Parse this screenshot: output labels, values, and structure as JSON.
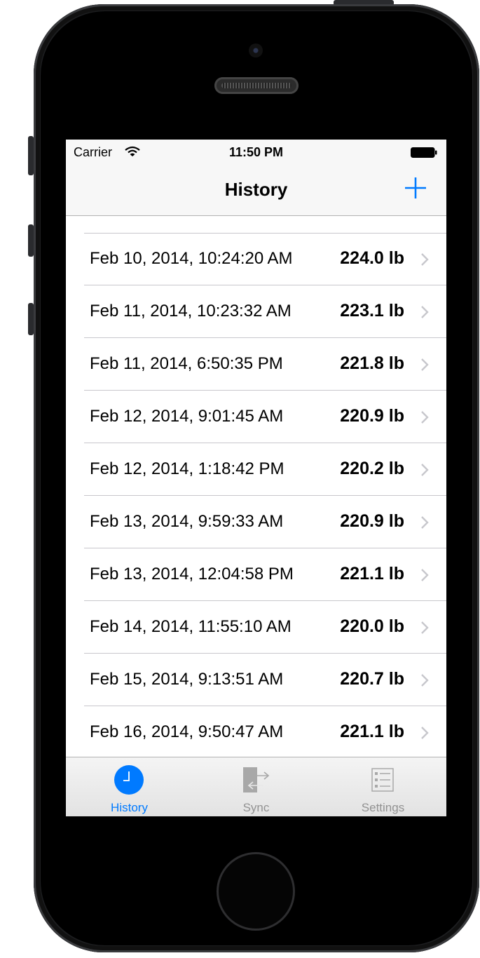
{
  "status_bar": {
    "carrier": "Carrier",
    "time": "11:50 PM"
  },
  "nav": {
    "title": "History",
    "add_icon": "plus-icon"
  },
  "entries": [
    {
      "date": "Feb 10, 2014, 10:24:20 AM",
      "weight": "224.0 lb"
    },
    {
      "date": "Feb 11, 2014, 10:23:32 AM",
      "weight": "223.1 lb"
    },
    {
      "date": "Feb 11, 2014, 6:50:35 PM",
      "weight": "221.8 lb"
    },
    {
      "date": "Feb 12, 2014, 9:01:45 AM",
      "weight": "220.9 lb"
    },
    {
      "date": "Feb 12, 2014, 1:18:42 PM",
      "weight": "220.2 lb"
    },
    {
      "date": "Feb 13, 2014, 9:59:33 AM",
      "weight": "220.9 lb"
    },
    {
      "date": "Feb 13, 2014, 12:04:58 PM",
      "weight": "221.1 lb"
    },
    {
      "date": "Feb 14, 2014, 11:55:10 AM",
      "weight": "220.0 lb"
    },
    {
      "date": "Feb 15, 2014, 9:13:51 AM",
      "weight": "220.7 lb"
    },
    {
      "date": "Feb 16, 2014, 9:50:47 AM",
      "weight": "221.1 lb"
    }
  ],
  "tabs": [
    {
      "label": "History",
      "icon": "clock-icon",
      "active": true
    },
    {
      "label": "Sync",
      "icon": "sync-icon",
      "active": false
    },
    {
      "label": "Settings",
      "icon": "list-icon",
      "active": false
    }
  ],
  "colors": {
    "accent": "#007aff",
    "inactive_tab": "#929292"
  }
}
